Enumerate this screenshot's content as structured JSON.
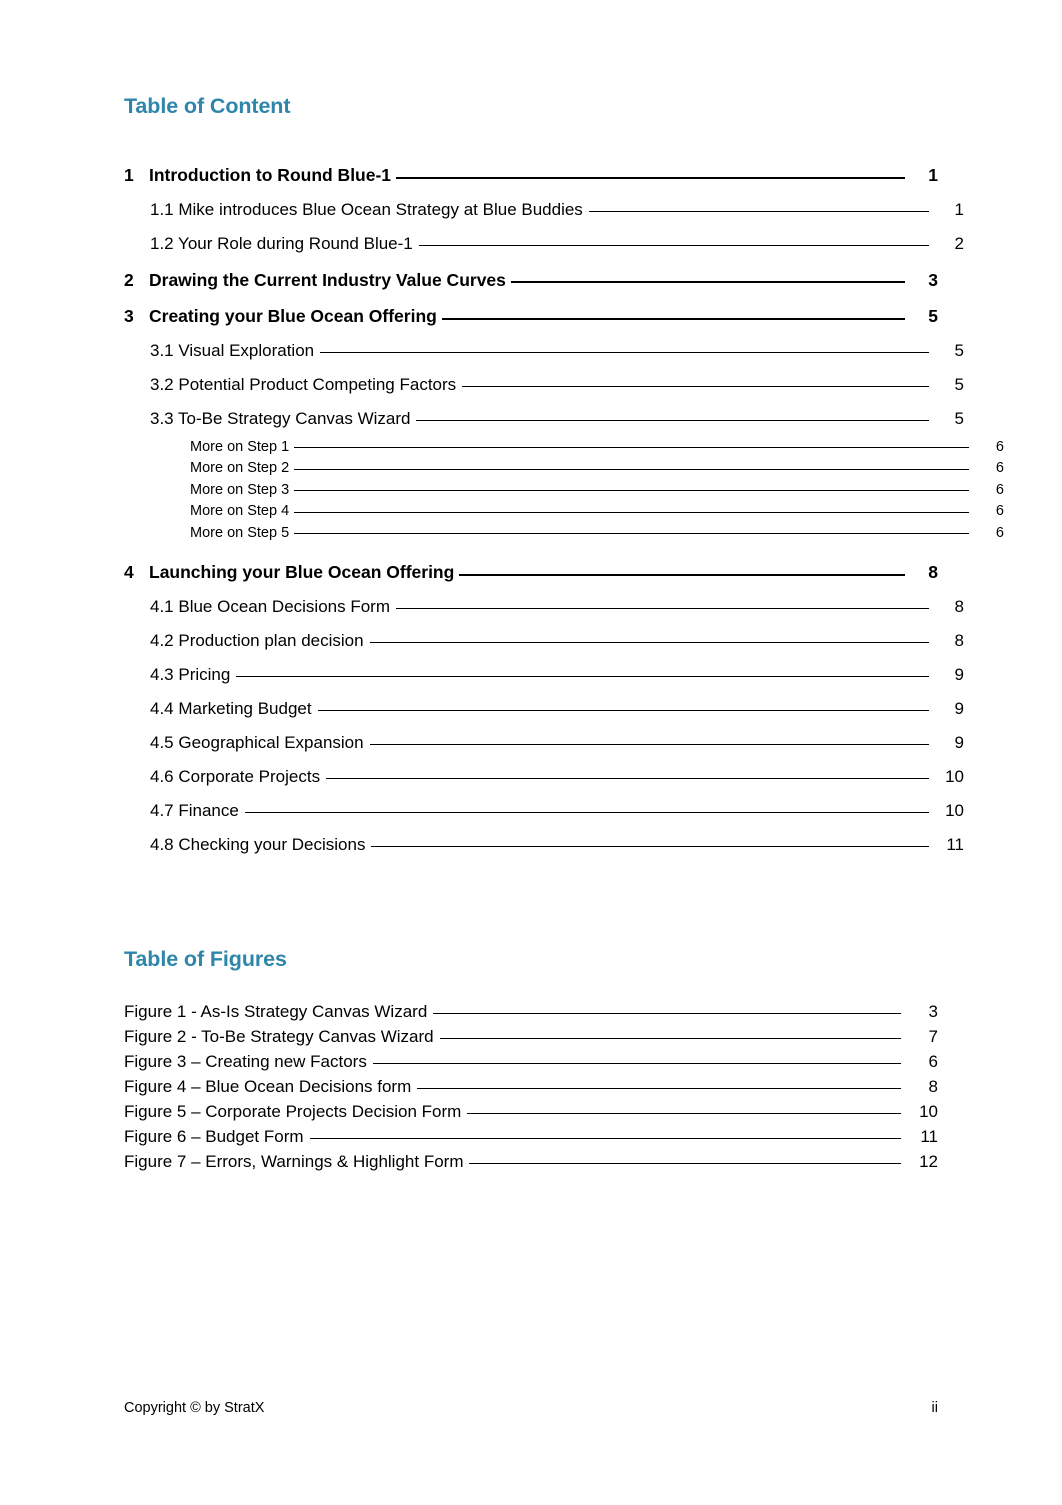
{
  "document": {
    "accent_color": "#2e86ab",
    "background_color": "#ffffff",
    "text_color": "#000000"
  },
  "toc": {
    "heading": "Table of Content",
    "entries": [
      {
        "level": 1,
        "number": "1",
        "label": "Introduction to Round Blue-1",
        "page": "1"
      },
      {
        "level": 2,
        "number": "",
        "label": "1.1  Mike introduces Blue Ocean Strategy at Blue Buddies",
        "page": "1"
      },
      {
        "level": 2,
        "number": "",
        "label": "1.2 Your Role during Round Blue-1",
        "page": "2"
      },
      {
        "level": 1,
        "number": "2",
        "label": "Drawing the Current Industry Value Curves",
        "page": "3"
      },
      {
        "level": 1,
        "number": "3",
        "label": "Creating your Blue Ocean Offering",
        "page": "5"
      },
      {
        "level": 2,
        "number": "",
        "label": "3.1 Visual Exploration",
        "page": "5"
      },
      {
        "level": 2,
        "number": "",
        "label": "3.2 Potential Product Competing Factors",
        "page": "5"
      },
      {
        "level": 2,
        "number": "",
        "label": "3.3 To-Be Strategy Canvas Wizard",
        "page": "5"
      },
      {
        "level": 3,
        "number": "",
        "label": "More on Step 1",
        "page": "6"
      },
      {
        "level": 3,
        "number": "",
        "label": "More on Step 2",
        "page": "6"
      },
      {
        "level": 3,
        "number": "",
        "label": "More on Step 3",
        "page": "6"
      },
      {
        "level": 3,
        "number": "",
        "label": "More on Step 4",
        "page": "6"
      },
      {
        "level": 3,
        "number": "",
        "label": "More on Step 5",
        "page": "6"
      },
      {
        "level": 1,
        "number": "4",
        "label": "Launching your Blue Ocean Offering",
        "page": "8"
      },
      {
        "level": 2,
        "number": "",
        "label": "4.1 Blue Ocean Decisions Form",
        "page": "8"
      },
      {
        "level": 2,
        "number": "",
        "label": "4.2 Production plan decision",
        "page": "8"
      },
      {
        "level": 2,
        "number": "",
        "label": "4.3 Pricing",
        "page": "9"
      },
      {
        "level": 2,
        "number": "",
        "label": "4.4 Marketing Budget",
        "page": "9"
      },
      {
        "level": 2,
        "number": "",
        "label": "4.5 Geographical Expansion",
        "page": "9"
      },
      {
        "level": 2,
        "number": "",
        "label": "4.6 Corporate Projects",
        "page": "10"
      },
      {
        "level": 2,
        "number": "",
        "label": "4.7 Finance",
        "page": "10"
      },
      {
        "level": 2,
        "number": "",
        "label": "4.8 Checking your Decisions",
        "page": "11"
      }
    ]
  },
  "figures": {
    "heading": "Table of Figures",
    "entries": [
      {
        "label": "Figure 1 - As-Is Strategy Canvas Wizard",
        "page": "3"
      },
      {
        "label": "Figure 2 - To-Be Strategy Canvas Wizard",
        "page": "7"
      },
      {
        "label": "Figure 3 – Creating new Factors",
        "page": "6"
      },
      {
        "label": "Figure 4 – Blue Ocean Decisions form",
        "page": "8"
      },
      {
        "label": "Figure 5 – Corporate Projects Decision Form",
        "page": "10"
      },
      {
        "label": "Figure 6 – Budget Form",
        "page": "11"
      },
      {
        "label": "Figure 7 – Errors, Warnings & Highlight Form",
        "page": "12"
      }
    ]
  },
  "footer": {
    "copyright": "Copyright © by StratX",
    "page_number": "ii"
  }
}
